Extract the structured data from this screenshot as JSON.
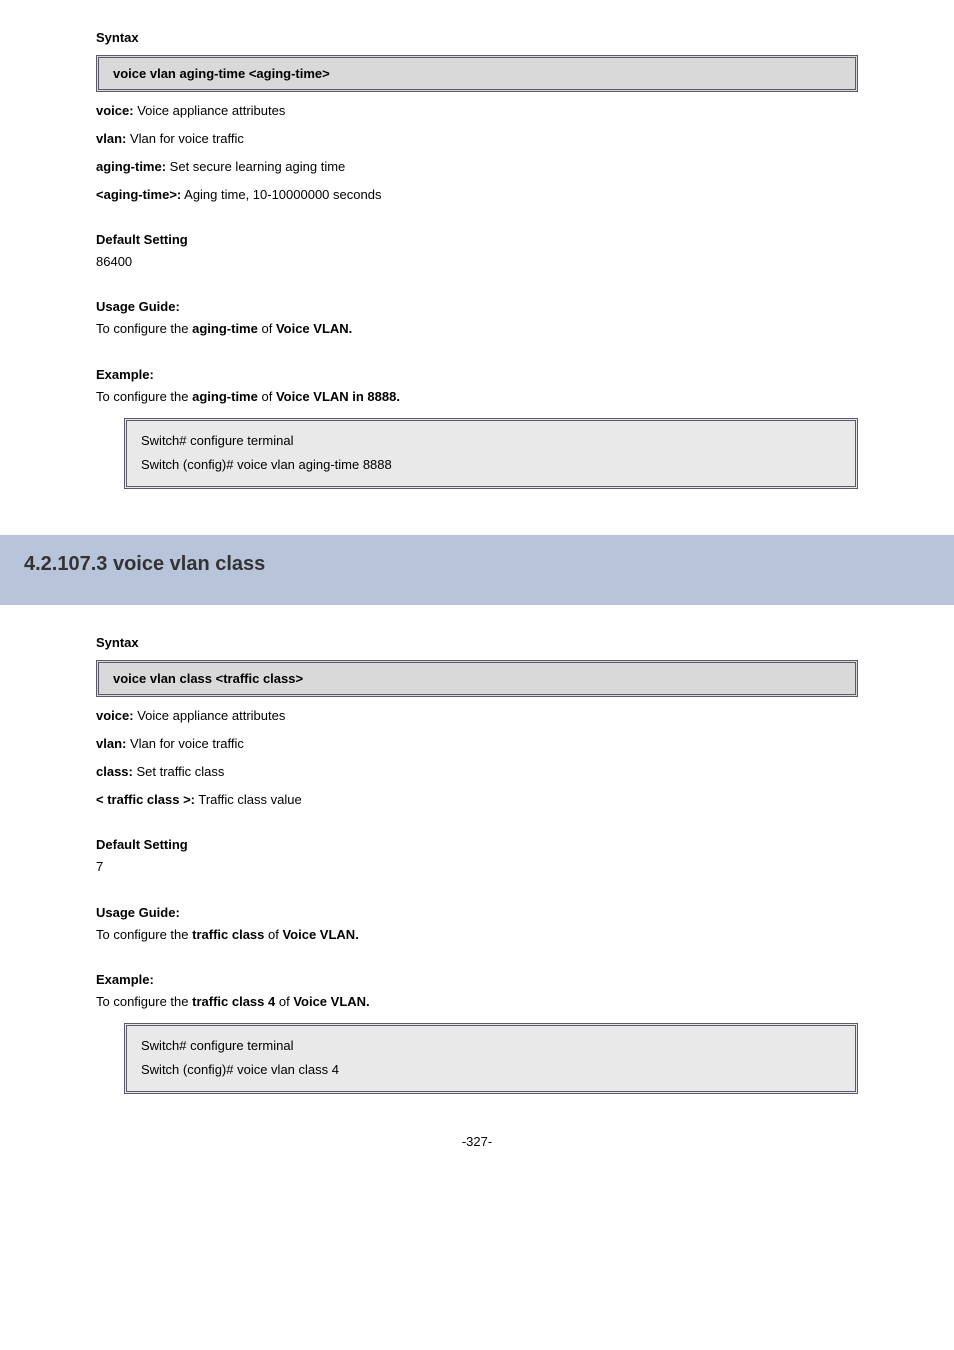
{
  "section1": {
    "syntax_label": "Syntax",
    "syntax_cmd": "voice vlan aging-time <aging-time>",
    "params": {
      "p1_kw": "voice:",
      "p1_desc": " Voice appliance attributes",
      "p2_kw": "vlan:",
      "p2_desc": " Vlan for voice traffic",
      "p3_kw": "aging-time:",
      "p3_desc": " Set secure learning aging time",
      "p4_kw": "<aging-time>:",
      "p4_desc": " Aging time, 10-10000000 seconds"
    },
    "default_label": "Default Setting",
    "default_value": "86400",
    "usage_label": "Usage Guide:",
    "usage_text_a": "To configure the ",
    "usage_text_b": "aging-time",
    "usage_text_c": " of ",
    "usage_text_d": "Voice VLAN.",
    "example_label": "Example:",
    "example_text_a": "To configure the ",
    "example_text_b": "aging-time",
    "example_text_c": " of ",
    "example_text_d": "Voice VLAN in 8888.",
    "example_box": "Switch# configure terminal\nSwitch (config)# voice vlan aging-time 8888"
  },
  "section2": {
    "header": "4.2.107.3 voice vlan class",
    "syntax_label": "Syntax",
    "syntax_cmd": "voice vlan class <traffic class>",
    "params": {
      "p1_kw": "voice:",
      "p1_desc": " Voice appliance attributes",
      "p2_kw": "vlan:",
      "p2_desc": " Vlan for voice traffic",
      "p3_kw": "class:",
      "p3_desc": " Set traffic class",
      "p4_kw": "< traffic class >:",
      "p4_desc": " Traffic class value"
    },
    "default_label": "Default Setting",
    "default_value": "7",
    "usage_label": "Usage Guide:",
    "usage_text_a": "To configure the ",
    "usage_text_b": "traffic class",
    "usage_text_c": " of ",
    "usage_text_d": "Voice VLAN.",
    "example_label": "Example:",
    "example_text_a": "To configure the ",
    "example_text_b": "traffic class 4",
    "example_text_c": " of ",
    "example_text_d": "Voice VLAN.",
    "example_box": "Switch# configure terminal\nSwitch (config)# voice vlan class 4"
  },
  "footer": "-327-"
}
